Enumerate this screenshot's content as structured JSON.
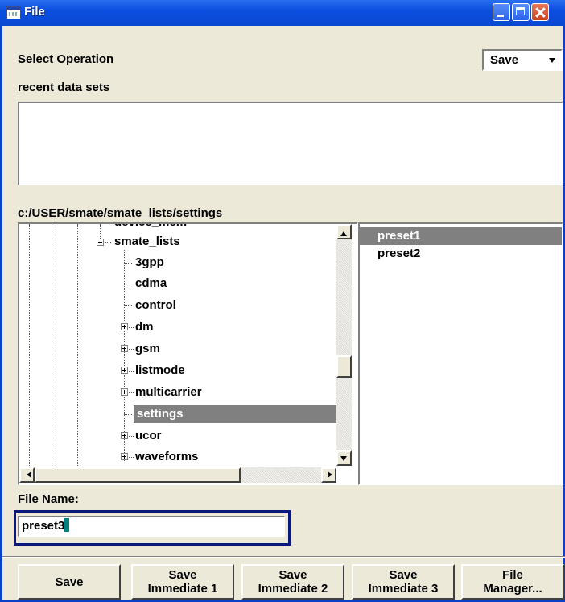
{
  "window": {
    "title": "File",
    "icon": "file-dialog-icon"
  },
  "operation": {
    "label": "Select Operation",
    "selected": "Save"
  },
  "recent": {
    "label": "recent data sets"
  },
  "path": "c:/USER/smate/smate_lists/settings",
  "tree": {
    "partial_top": "device_mem",
    "parent": "smate_lists",
    "items": [
      {
        "label": "3gpp",
        "expandable": false
      },
      {
        "label": "cdma",
        "expandable": false
      },
      {
        "label": "control",
        "expandable": false
      },
      {
        "label": "dm",
        "expandable": true
      },
      {
        "label": "gsm",
        "expandable": true
      },
      {
        "label": "listmode",
        "expandable": true
      },
      {
        "label": "multicarrier",
        "expandable": true
      },
      {
        "label": "settings",
        "expandable": false,
        "selected": true
      },
      {
        "label": "ucor",
        "expandable": true
      },
      {
        "label": "waveforms",
        "expandable": true
      }
    ]
  },
  "files": {
    "items": [
      {
        "label": "preset1",
        "selected": true
      },
      {
        "label": "preset2",
        "selected": false
      }
    ]
  },
  "filename": {
    "label": "File Name:",
    "value": "preset3"
  },
  "buttons": {
    "save": "Save",
    "save_immediate_1": "Save\nImmediate 1",
    "save_immediate_2": "Save\nImmediate 2",
    "save_immediate_3": "Save\nImmediate 3",
    "file_manager": "File\nManager..."
  },
  "colors": {
    "title_bar": "#0b4fe0",
    "selection": "#808080",
    "dialog_bg": "#ece9d8",
    "focus_border": "#0a1a7a",
    "caret": "#008080"
  }
}
